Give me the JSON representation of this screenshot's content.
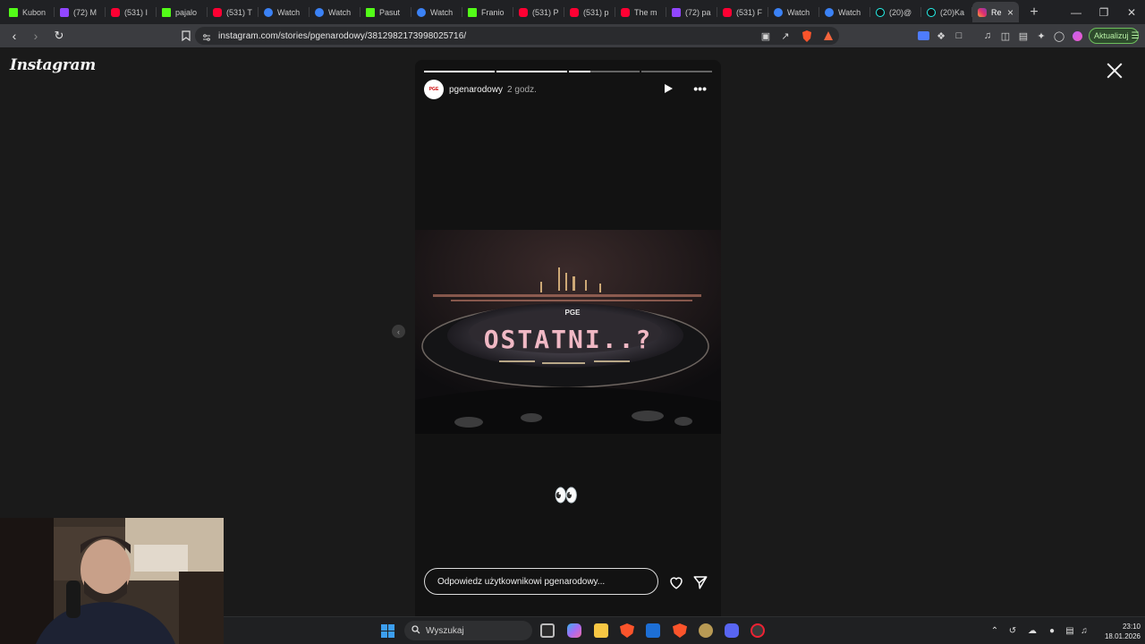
{
  "browser": {
    "tabs": [
      {
        "label": "Kubon",
        "icon": "kick-icon",
        "kind": "k"
      },
      {
        "label": "(72) M",
        "icon": "twitch-icon",
        "kind": "tw"
      },
      {
        "label": "(531) I",
        "icon": "youtube-icon",
        "kind": "yt"
      },
      {
        "label": "pajalo",
        "icon": "kick-icon",
        "kind": "k"
      },
      {
        "label": "(531) T",
        "icon": "youtube-icon",
        "kind": "yt"
      },
      {
        "label": "Watch",
        "icon": "go-icon",
        "kind": "go"
      },
      {
        "label": "Watch",
        "icon": "go-icon",
        "kind": "go"
      },
      {
        "label": "Pasut",
        "icon": "kick-icon",
        "kind": "k"
      },
      {
        "label": "Watch",
        "icon": "go-icon",
        "kind": "go"
      },
      {
        "label": "Franio",
        "icon": "kick-icon",
        "kind": "k"
      },
      {
        "label": "(531) P",
        "icon": "youtube-icon",
        "kind": "yt"
      },
      {
        "label": "(531) p",
        "icon": "youtube-icon",
        "kind": "yt"
      },
      {
        "label": "The m",
        "icon": "youtube-icon",
        "kind": "yt"
      },
      {
        "label": "(72) pa",
        "icon": "twitch-icon",
        "kind": "tw"
      },
      {
        "label": "(531) F",
        "icon": "youtube-icon",
        "kind": "yt"
      },
      {
        "label": "Watch",
        "icon": "go-icon",
        "kind": "go"
      },
      {
        "label": "Watch",
        "icon": "go-icon",
        "kind": "go"
      },
      {
        "label": "(20)@",
        "icon": "tiktok-icon",
        "kind": "tt"
      },
      {
        "label": "(20)Ka",
        "icon": "tiktok-icon",
        "kind": "tt"
      },
      {
        "label": "Re",
        "icon": "instagram-icon",
        "kind": "ig",
        "active": true
      }
    ],
    "new_tab": "+",
    "url": "instagram.com/stories/pgenarodowy/3812982173998025716/",
    "update_label": "Aktualizuj",
    "shield_badge": "1"
  },
  "page": {
    "logo": "Instagram",
    "story": {
      "progress": [
        1.0,
        1.0,
        0.3,
        0.0
      ],
      "avatar_text": "PGE",
      "username": "pgenarodowy",
      "time": "2 godz.",
      "more": "•••",
      "photo_text": "OSTATNI..?",
      "photo_brand": "PGE",
      "caption_emoji": "👀",
      "reply_placeholder": "Odpowiedz użytkownikowi pgenarodowy..."
    }
  },
  "taskbar": {
    "search_label": "Wyszukaj",
    "time": "23:10",
    "date": "18.01.2026"
  }
}
